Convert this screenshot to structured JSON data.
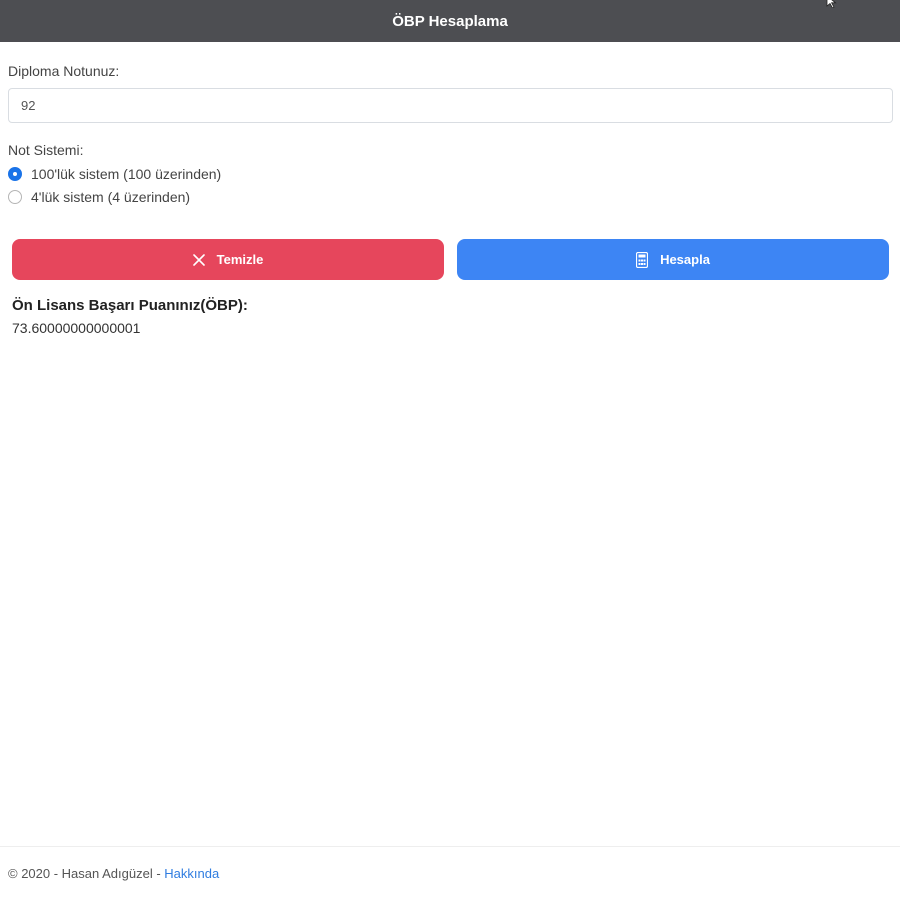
{
  "header": {
    "title": "ÖBP Hesaplama"
  },
  "form": {
    "grade_label": "Diploma Notunuz:",
    "grade_value": "92",
    "system_label": "Not Sistemi:",
    "options": [
      {
        "label": "100'lük sistem (100 üzerinden)",
        "selected": true
      },
      {
        "label": "4'lük sistem (4 üzerinden)",
        "selected": false
      }
    ]
  },
  "buttons": {
    "clear_label": "Temizle",
    "calculate_label": "Hesapla",
    "clear_icon": "close-icon",
    "calculate_icon": "calculator-icon",
    "clear_color": "#e6465c",
    "calculate_color": "#3d85f4"
  },
  "result": {
    "title": "Ön Lisans Başarı Puanınız(ÖBP):",
    "value": "73.60000000000001"
  },
  "footer": {
    "text": "© 2020 - Hasan Adıgüzel - ",
    "link_label": "Hakkında"
  }
}
